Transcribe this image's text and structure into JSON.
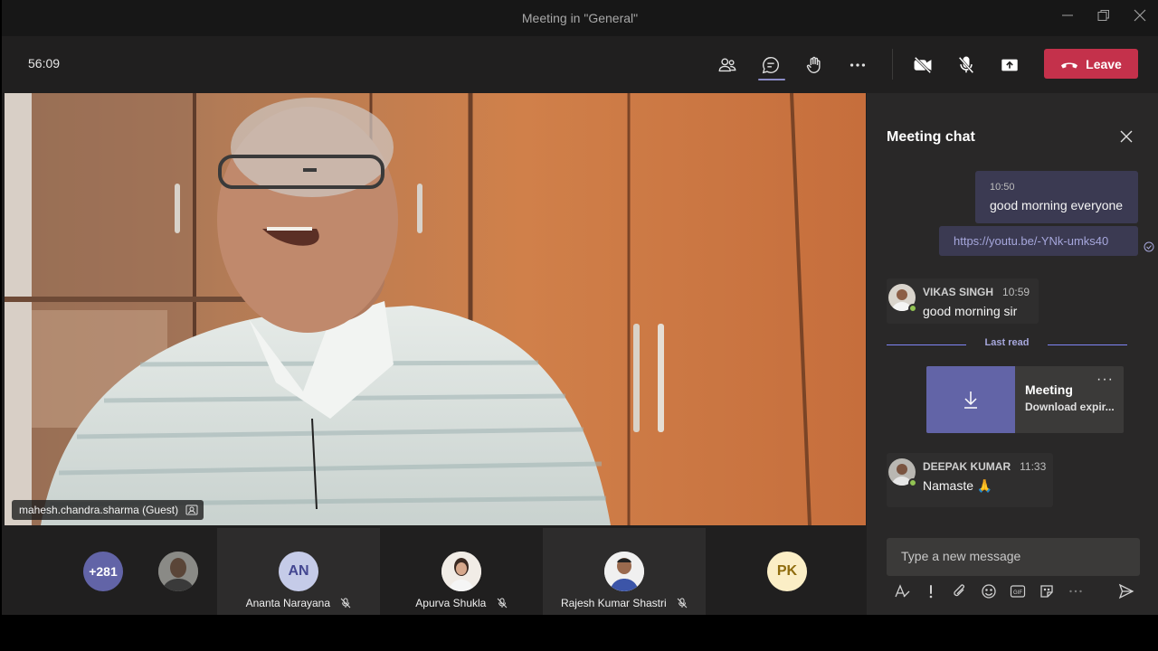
{
  "window": {
    "title": "Meeting in \"General\""
  },
  "toolbar": {
    "timer": "56:09",
    "leave_label": "Leave",
    "icons": [
      "participants-icon",
      "chat-icon",
      "raise-hand-icon",
      "more-icon",
      "camera-off-icon",
      "mic-off-icon",
      "share-icon",
      "phone-icon"
    ]
  },
  "video": {
    "presenter_label": "mahesh.chandra.sharma (Guest)"
  },
  "participants": {
    "overflow_count": "+281",
    "tiles": [
      {
        "initials": "",
        "name": ""
      },
      {
        "initials": "AN",
        "name": "Ananta Narayana",
        "muted": true
      },
      {
        "initials": "",
        "name": "Apurva Shukla",
        "muted": true
      },
      {
        "initials": "",
        "name": "Rajesh Kumar Shastri",
        "muted": true
      },
      {
        "initials": "PK",
        "name": ""
      }
    ]
  },
  "chat": {
    "title": "Meeting chat",
    "messages": [
      {
        "time": "10:50",
        "text": "good morning everyone"
      },
      {
        "text": "https://youtu.be/-YNk-umks40"
      },
      {
        "author": "VIKAS SINGH",
        "time": "10:59",
        "text": "good morning sir"
      },
      {
        "author": "DEEPAK KUMAR",
        "time": "11:33",
        "text": "Namaste 🙏"
      }
    ],
    "last_read_label": "Last read",
    "card": {
      "title": "Meeting",
      "subtitle": "Download expir..."
    },
    "compose_placeholder": "Type a new message"
  },
  "colors": {
    "leave": "#c4314b",
    "accent": "#6264a7",
    "overflow_badge": "#6264a7",
    "an_avatar": "#c5cbe8",
    "pk_avatar": "#fbeec6"
  }
}
